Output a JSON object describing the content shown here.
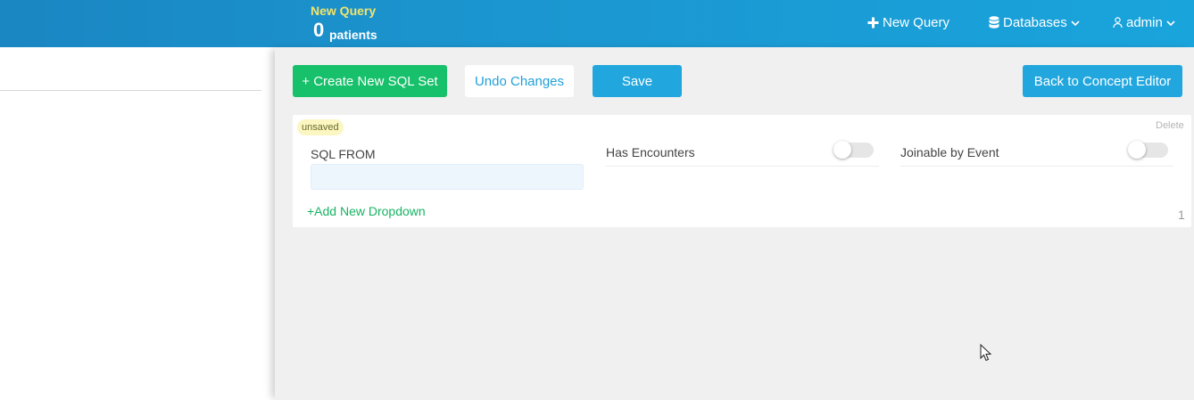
{
  "header": {
    "query_title": "New Query",
    "patient_count": "0",
    "patient_label": "patients",
    "nav": {
      "new_query": "New Query",
      "databases": "Databases",
      "user": "admin"
    }
  },
  "toolbar": {
    "create_label": "+ Create New SQL Set",
    "undo_label": "Undo Changes",
    "save_label": "Save",
    "back_label": "Back to Concept Editor"
  },
  "sql_set": {
    "status_badge": "unsaved",
    "delete_label": "Delete",
    "sql_from_label": "SQL FROM",
    "sql_from_value": "",
    "has_encounters_label": "Has Encounters",
    "has_encounters_on": false,
    "joinable_label": "Joinable by Event",
    "joinable_on": false,
    "add_dropdown_label": "+Add New Dropdown",
    "index": "1"
  },
  "colors": {
    "header_accent": "#1b95cf",
    "query_title": "#f2e36a",
    "create_button": "#17c06a",
    "primary_button": "#21a7de",
    "add_link": "#17b463"
  }
}
